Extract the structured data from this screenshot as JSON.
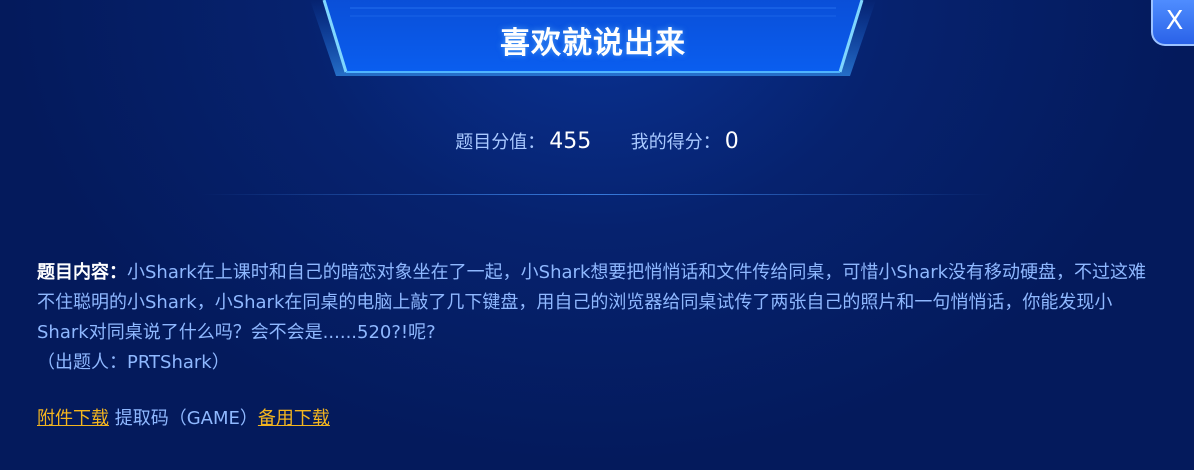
{
  "dialog": {
    "title": "喜欢就说出来",
    "close_label": "X"
  },
  "score": {
    "value_label": "题目分值：",
    "value": "455",
    "my_score_label": "我的得分：",
    "my_score": "0"
  },
  "content": {
    "label": "题目内容：",
    "text": "小Shark在上课时和自己的暗恋对象坐在了一起，小Shark想要把悄悄话和文件传给同桌，可惜小Shark没有移动硬盘，不过这难不住聪明的小Shark，小Shark在同桌的电脑上敲了几下键盘，用自己的浏览器给同桌试传了两张自己的照片和一句悄悄话，你能发现小Shark对同桌说了什么吗？会不会是......520?!呢?",
    "author": "（出题人：PRTShark）"
  },
  "links": {
    "attachment_label": "附件下载",
    "code_text": "提取码（GAME）",
    "backup_label": "备用下载"
  },
  "colors": {
    "background": "#041a5c",
    "accent": "#2a62e8",
    "link": "#f3b51f",
    "text": "#8fb8ff"
  }
}
